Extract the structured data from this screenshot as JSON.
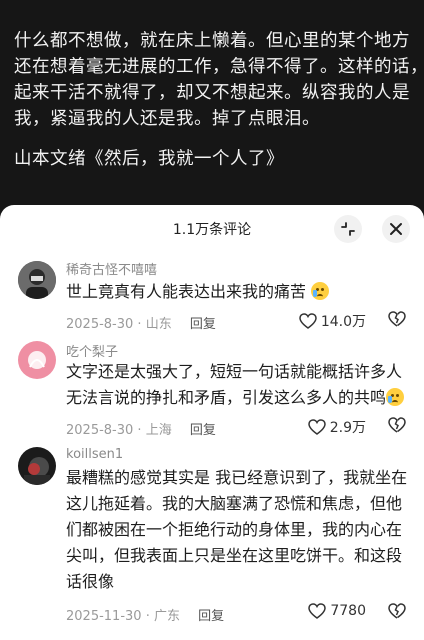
{
  "post": {
    "lines": [
      "什么都不想做，就在床上懒着。但心里的某个地方",
      "还在想着毫无进展的工作，急得不得了。这样的话，",
      "起来干活不就得了，却又不想起来。纵容我的人是",
      "我，紧逼我的人还是我。掉了点眼泪。",
      "山本文绪《然后，我就一个人了》"
    ]
  },
  "sheet": {
    "title": "1.1万条评论"
  },
  "comments": [
    {
      "username": "稀奇古怪不嘻嘻",
      "lines": [
        "世上竟真有人能表达出来我的痛苦"
      ],
      "emoji": "crying-face",
      "date": "2025-8-30",
      "location": "山东",
      "reply_label": "回复",
      "likes": "14.0万"
    },
    {
      "username": "吃个梨子",
      "lines": [
        "文字还是太强大了，短短一句话就能概括许多人",
        "无法言说的挣扎和矛盾，引发这么多人的共鸣"
      ],
      "emoji": "crying-face",
      "date": "2025-8-30",
      "location": "上海",
      "reply_label": "回复",
      "likes": "2.9万"
    },
    {
      "username": "koillsen1",
      "lines": [
        "最糟糕的感觉其实是 我已经意识到了，我就坐在",
        "这儿拖延着。我的大脑塞满了恐慌和焦虑，但他",
        "们都被困在一个拒绝行动的身体里，我的内心在",
        "尖叫，但我表面上只是坐在这里吃饼干。和这段",
        "话很像"
      ],
      "date": "2025-11-30",
      "location": "广东",
      "reply_label": "回复",
      "likes": "7780"
    }
  ],
  "colors": {
    "background_dark": "#161616",
    "sheet": "#ffffff",
    "meta": "#9a9a9a"
  }
}
